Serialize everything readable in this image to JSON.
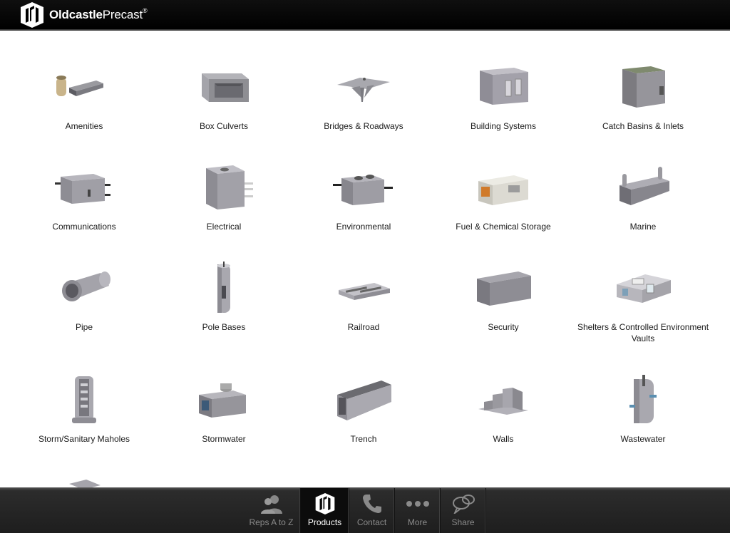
{
  "header": {
    "brand_bold": "Oldcastle",
    "brand_light": "Precast",
    "brand_mark": "®"
  },
  "products": [
    {
      "label": "Amenities",
      "icon": "amenities-icon"
    },
    {
      "label": "Box Culverts",
      "icon": "box-culvert-icon"
    },
    {
      "label": "Bridges & Roadways",
      "icon": "bridge-icon"
    },
    {
      "label": "Building Systems",
      "icon": "building-icon"
    },
    {
      "label": "Catch Basins & Inlets",
      "icon": "catch-basin-icon"
    },
    {
      "label": "Communications",
      "icon": "communications-vault-icon"
    },
    {
      "label": "Electrical",
      "icon": "electrical-vault-icon"
    },
    {
      "label": "Environmental",
      "icon": "environmental-tank-icon"
    },
    {
      "label": "Fuel & Chemical Storage",
      "icon": "fuel-tank-icon"
    },
    {
      "label": "Marine",
      "icon": "marine-dock-icon"
    },
    {
      "label": "Pipe",
      "icon": "pipe-icon"
    },
    {
      "label": "Pole Bases",
      "icon": "pole-base-icon"
    },
    {
      "label": "Railroad",
      "icon": "railroad-tie-icon"
    },
    {
      "label": "Security",
      "icon": "security-barrier-icon"
    },
    {
      "label": "Shelters & Controlled Environment Vaults",
      "icon": "shelter-icon"
    },
    {
      "label": "Storm/Sanitary Maholes",
      "icon": "manhole-icon"
    },
    {
      "label": "Stormwater",
      "icon": "stormwater-icon"
    },
    {
      "label": "Trench",
      "icon": "trench-icon"
    },
    {
      "label": "Walls",
      "icon": "retaining-wall-icon"
    },
    {
      "label": "Wastewater",
      "icon": "wastewater-icon"
    }
  ],
  "tabbar": {
    "tabs": [
      {
        "label": "Reps A to Z",
        "icon": "people-icon",
        "active": false
      },
      {
        "label": "Products",
        "icon": "oldcastle-logo-icon",
        "active": true
      },
      {
        "label": "Contact",
        "icon": "phone-icon",
        "active": false
      },
      {
        "label": "More",
        "icon": "more-dots-icon",
        "active": false
      },
      {
        "label": "Share",
        "icon": "share-bubbles-icon",
        "active": false
      }
    ]
  }
}
